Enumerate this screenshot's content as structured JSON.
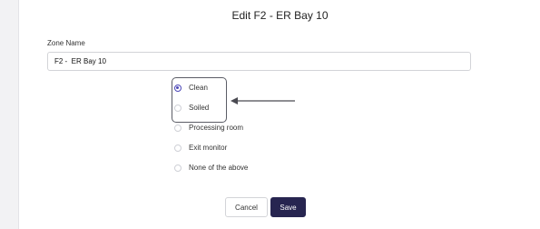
{
  "dialog": {
    "title": "Edit F2 - ER Bay 10",
    "zone_name_label": "Zone Name",
    "zone_name_value": "F2 -  ER Bay 10"
  },
  "options": [
    {
      "label": "Clean",
      "selected": true
    },
    {
      "label": "Soiled",
      "selected": false
    },
    {
      "label": "Processing room",
      "selected": false
    },
    {
      "label": "Exit monitor",
      "selected": false
    },
    {
      "label": "None of the above",
      "selected": false
    }
  ],
  "buttons": {
    "cancel_label": "Cancel",
    "save_label": "Save"
  },
  "colors": {
    "accent": "#4d49b8",
    "save_button": "#272550"
  }
}
